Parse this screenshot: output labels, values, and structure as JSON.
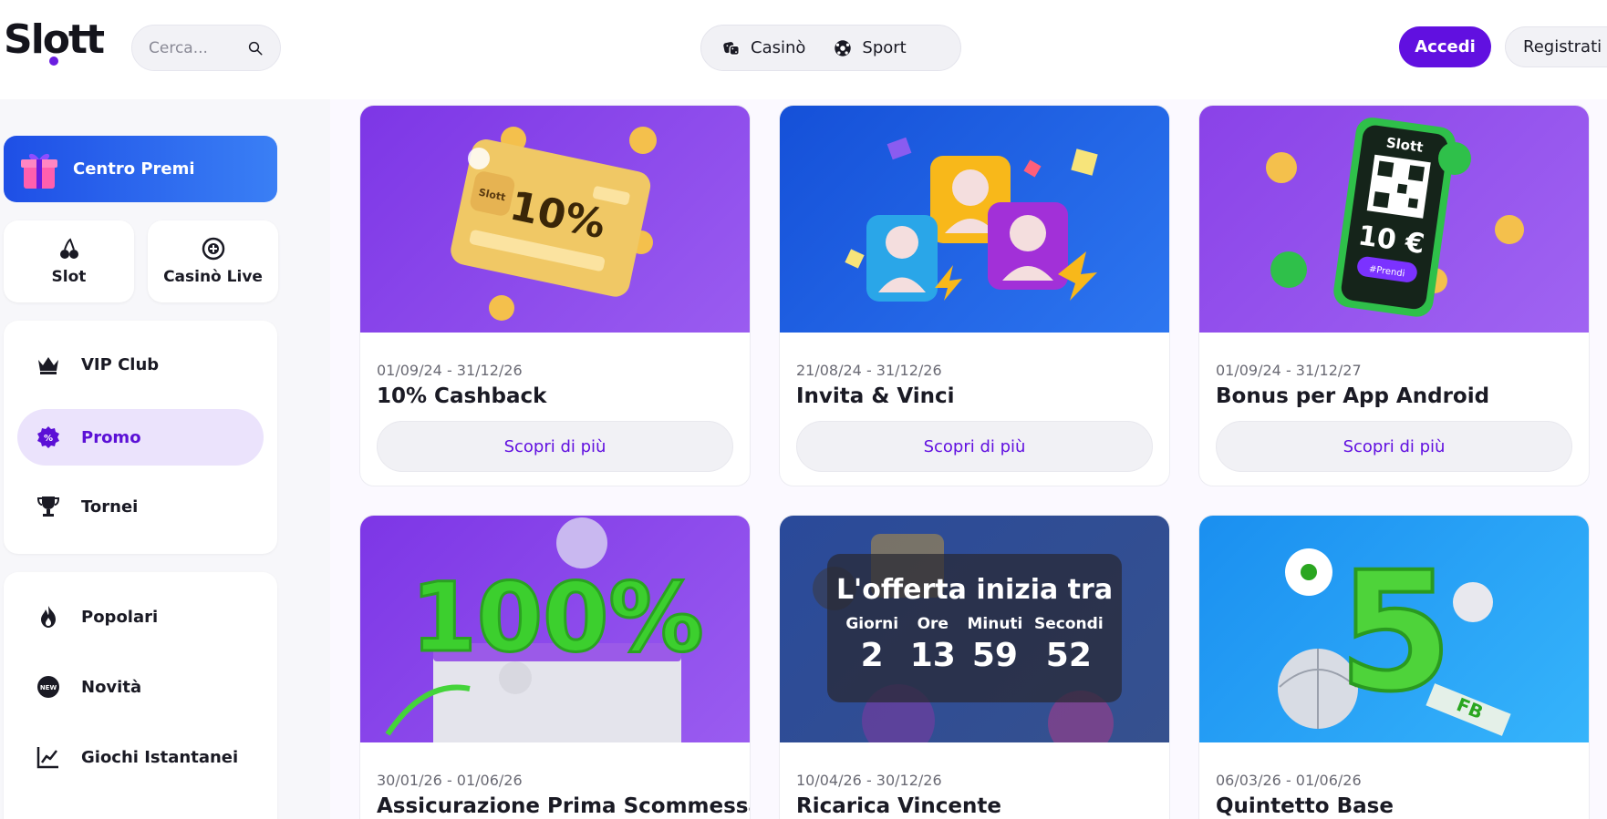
{
  "header": {
    "logo": "Slott",
    "search_placeholder": "Cerca...",
    "nav": [
      {
        "label": "Casinò",
        "icon": "dice-icon"
      },
      {
        "label": "Sport",
        "icon": "soccer-ball-icon"
      }
    ],
    "login_label": "Accedi",
    "register_label": "Registrati"
  },
  "sidebar": {
    "rewards_label": "Centro Premi",
    "quick": [
      {
        "label": "Slot",
        "icon": "cherries-icon"
      },
      {
        "label": "Casinò Live",
        "icon": "chip-icon"
      }
    ],
    "menu1": [
      {
        "label": "VIP Club",
        "icon": "crown-icon",
        "active": false
      },
      {
        "label": "Promo",
        "icon": "promo-badge-icon",
        "active": true
      },
      {
        "label": "Tornei",
        "icon": "trophy-icon",
        "active": false
      }
    ],
    "menu2": [
      {
        "label": "Popolari",
        "icon": "flame-icon"
      },
      {
        "label": "Novità",
        "icon": "new-badge-icon"
      },
      {
        "label": "Giochi Istantanei",
        "icon": "chart-line-icon"
      }
    ]
  },
  "promos": [
    {
      "date": "01/09/24 - 31/12/26",
      "title": "10% Cashback",
      "button": "Scopri di più",
      "badge": "10%"
    },
    {
      "date": "21/08/24 - 31/12/26",
      "title": "Invita & Vinci",
      "button": "Scopri di più"
    },
    {
      "date": "01/09/24 - 31/12/27",
      "title": "Bonus per App Android",
      "button": "Scopri di più",
      "badge": "10 €",
      "brand": "Slott",
      "tag": "#Prendi"
    },
    {
      "date": "30/01/26 - 01/06/26",
      "title": "Assicurazione Prima Scommessa",
      "badge": "100%"
    },
    {
      "date": "10/04/26 - 30/12/26",
      "title": "Ricarica Vincente"
    },
    {
      "date": "06/03/26 - 01/06/26",
      "title": "Quintetto Base",
      "badge": "5",
      "tag": "FB"
    }
  ],
  "countdown": {
    "title": "L'offerta inizia tra",
    "labels": [
      "Giorni",
      "Ore",
      "Minuti",
      "Secondi"
    ],
    "values": [
      "2",
      "13",
      "59",
      "52"
    ]
  },
  "colors": {
    "accent": "#6110e0",
    "promo_active_bg": "#ebe3fc",
    "rewards_gradient": "#1e4fe6"
  }
}
